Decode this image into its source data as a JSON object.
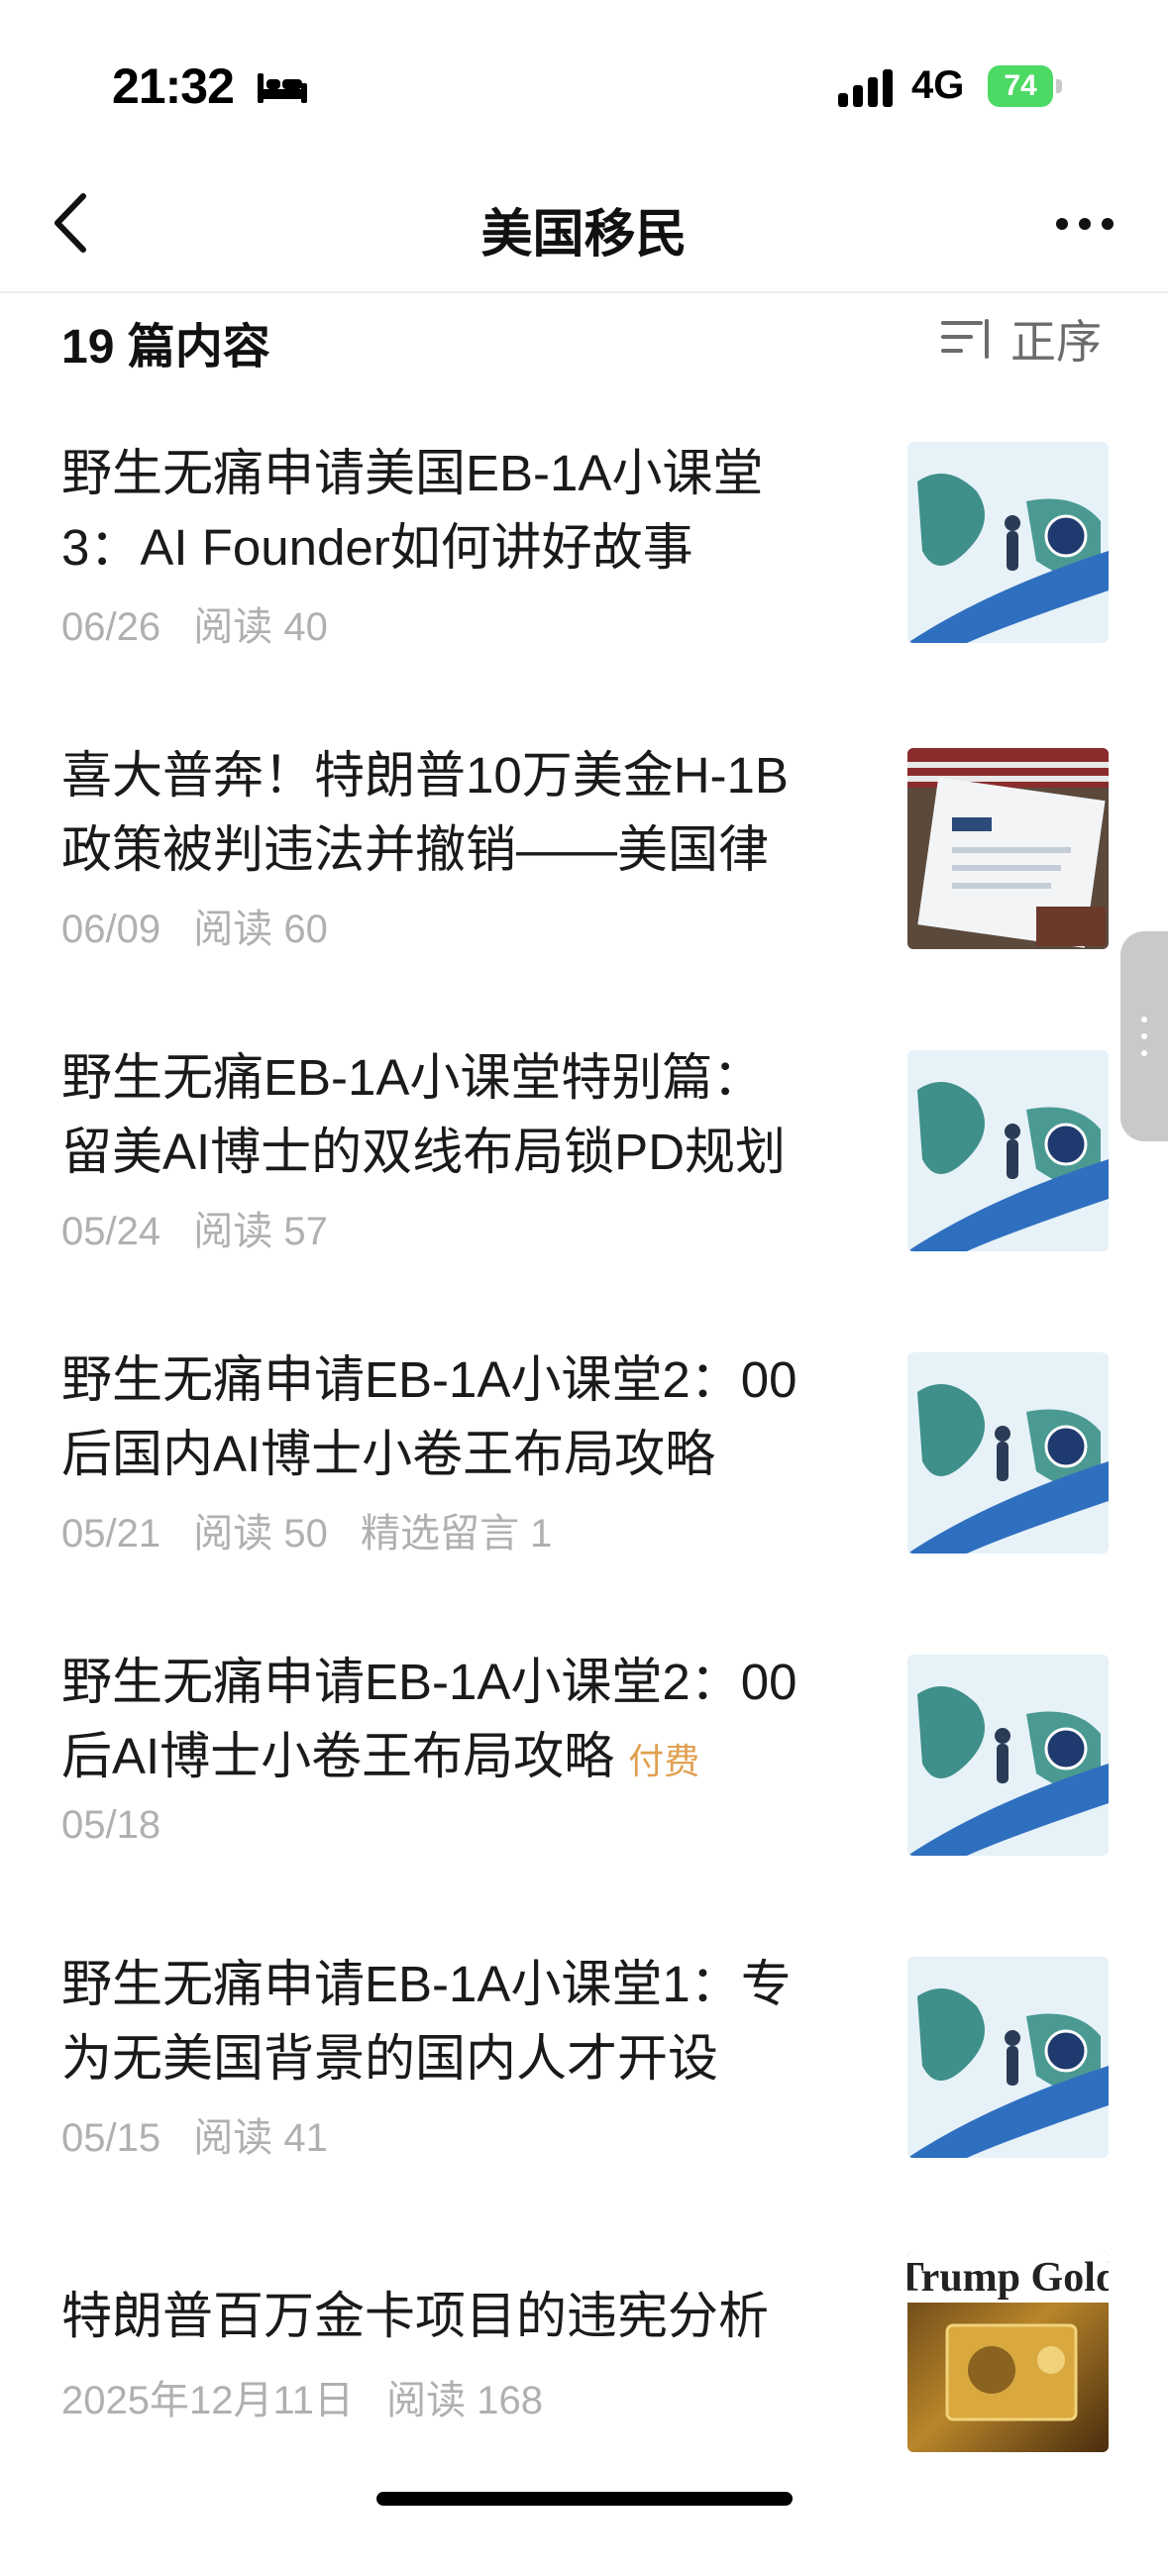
{
  "status_bar": {
    "time": "21:32",
    "network": "4G",
    "battery": "74"
  },
  "nav": {
    "title": "美国移民"
  },
  "list": {
    "count_label": "19 篇内容",
    "sort_label": "正序"
  },
  "articles": [
    {
      "title_lines": [
        "野生无痛申请美国EB-1A小课堂",
        "3：AI Founder如何讲好故事"
      ],
      "date": "06/26",
      "reads": "阅读 40",
      "extra": "",
      "paid": "",
      "thumb": "map-illustration"
    },
    {
      "title_lines": [
        "喜大普奔！特朗普10万美金H-1B",
        "政策被判违法并撤销——美国律"
      ],
      "date": "06/09",
      "reads": "阅读 60",
      "extra": "",
      "paid": "",
      "thumb": "h1b-form"
    },
    {
      "title_lines": [
        "野生无痛EB-1A小课堂特别篇：",
        "留美AI博士的双线布局锁PD规划"
      ],
      "date": "05/24",
      "reads": "阅读 57",
      "extra": "",
      "paid": "",
      "thumb": "map-illustration"
    },
    {
      "title_lines": [
        "野生无痛申请EB-1A小课堂2：00",
        "后国内AI博士小卷王布局攻略"
      ],
      "date": "05/21",
      "reads": "阅读 50",
      "extra": "精选留言 1",
      "paid": "",
      "thumb": "map-illustration"
    },
    {
      "title_lines": [
        "野生无痛申请EB-1A小课堂2：00",
        "后AI博士小卷王布局攻略"
      ],
      "date": "05/18",
      "reads": "",
      "extra": "",
      "paid": "付费",
      "thumb": "map-illustration"
    },
    {
      "title_lines": [
        "野生无痛申请EB-1A小课堂1：专",
        "为无美国背景的国内人才开设"
      ],
      "date": "05/15",
      "reads": "阅读 41",
      "extra": "",
      "paid": "",
      "thumb": "map-illustration"
    },
    {
      "title_lines": [
        "特朗普百万金卡项目的违宪分析"
      ],
      "date": "2025年12月11日",
      "reads": "阅读 168",
      "extra": "",
      "paid": "",
      "thumb": "gold-card",
      "thumb_text": "Trump Gold"
    }
  ],
  "colors": {
    "paid": "#e0a050",
    "meta": "#b0b0b0",
    "battery": "#4cd964"
  }
}
